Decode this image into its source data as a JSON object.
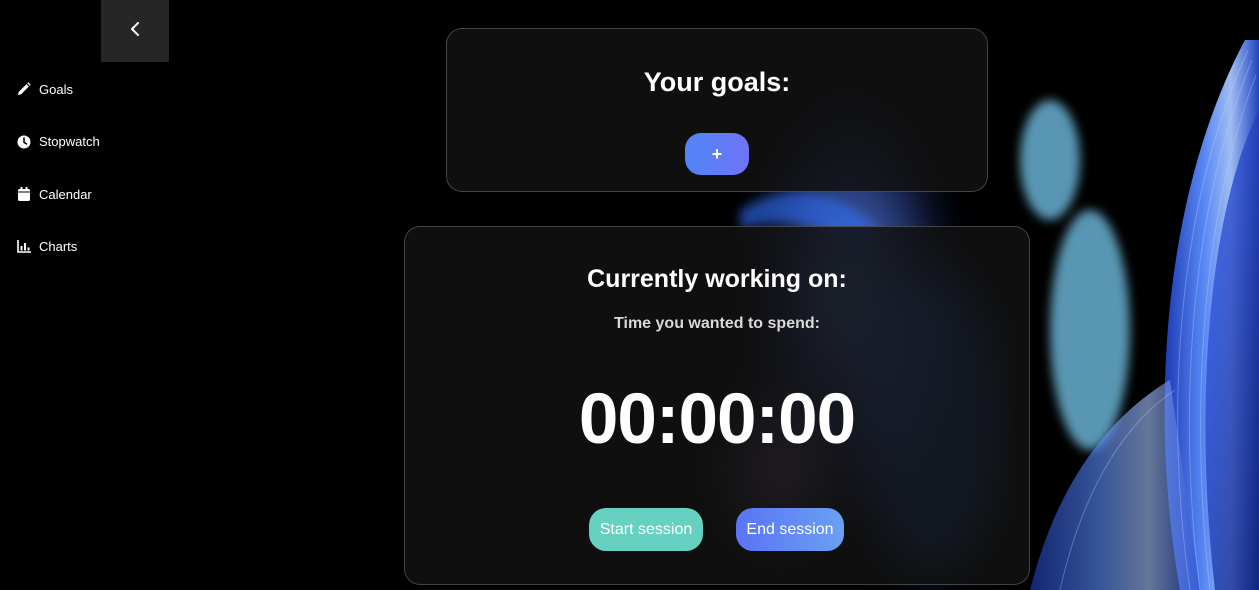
{
  "sidebar": {
    "collapse_icon": "chevron-left-icon",
    "items": [
      {
        "label": "Goals",
        "icon": "pencil-icon"
      },
      {
        "label": "Stopwatch",
        "icon": "clock-icon"
      },
      {
        "label": "Calendar",
        "icon": "calendar-icon"
      },
      {
        "label": "Charts",
        "icon": "chart-icon"
      }
    ]
  },
  "goals": {
    "title": "Your goals:",
    "add_label": "+"
  },
  "work": {
    "title": "Currently working on:",
    "subtitle": "Time you wanted to spend:",
    "timer": "00:00:00",
    "start_label": "Start session",
    "end_label": "End session"
  },
  "colors": {
    "background": "#000000",
    "card": "#121212",
    "accent_blue": "#5a80f6",
    "start_teal": "#66d1c0"
  }
}
